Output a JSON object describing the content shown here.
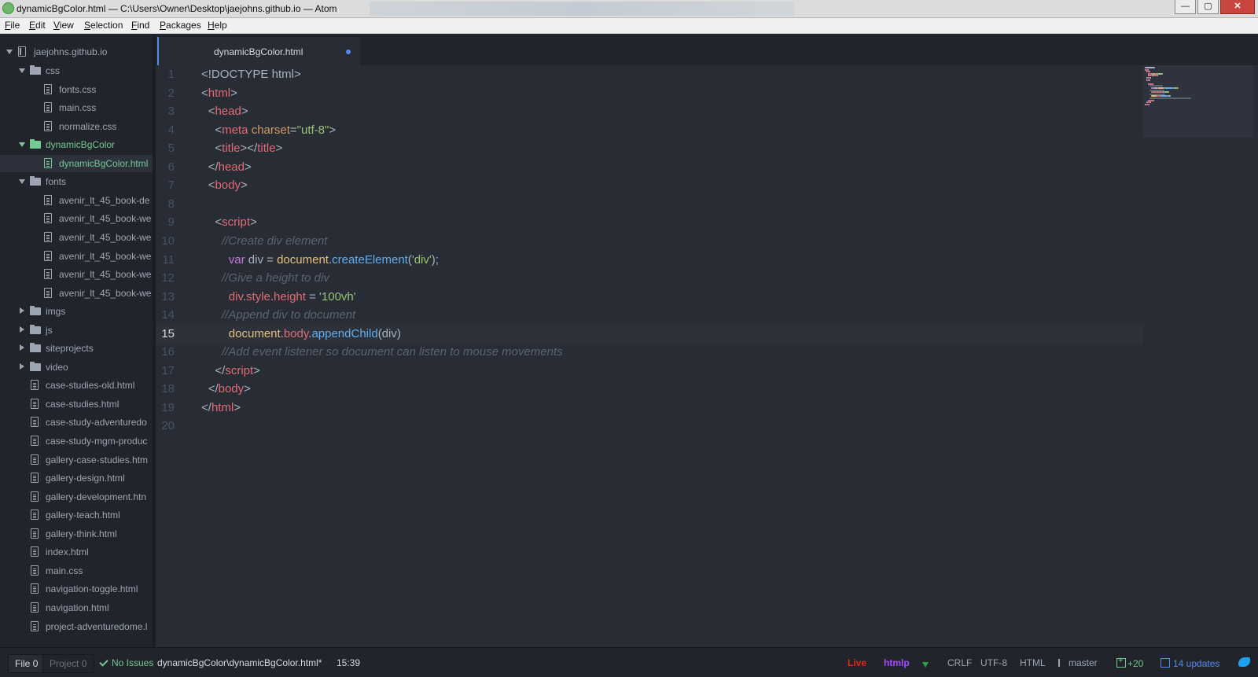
{
  "window": {
    "title": "dynamicBgColor.html — C:\\Users\\Owner\\Desktop\\jaejohns.github.io — Atom",
    "buttons": {
      "minimize": "—",
      "maximize": "▢",
      "close": "✕"
    }
  },
  "menu": [
    "File",
    "Edit",
    "View",
    "Selection",
    "Find",
    "Packages",
    "Help"
  ],
  "tree": {
    "root": "jaejohns.github.io",
    "items": [
      {
        "label": "css",
        "type": "folder",
        "expanded": true,
        "depth": 1
      },
      {
        "label": "fonts.css",
        "type": "file",
        "depth": 2
      },
      {
        "label": "main.css",
        "type": "file",
        "depth": 2
      },
      {
        "label": "normalize.css",
        "type": "file",
        "depth": 2
      },
      {
        "label": "dynamicBgColor",
        "type": "folder",
        "expanded": true,
        "depth": 1,
        "status": "added"
      },
      {
        "label": "dynamicBgColor.html",
        "type": "file",
        "depth": 2,
        "status": "added",
        "selected": true
      },
      {
        "label": "fonts",
        "type": "folder",
        "expanded": true,
        "depth": 1
      },
      {
        "label": "avenir_lt_45_book-de",
        "type": "file",
        "depth": 2
      },
      {
        "label": "avenir_lt_45_book-we",
        "type": "file",
        "depth": 2
      },
      {
        "label": "avenir_lt_45_book-we",
        "type": "file",
        "depth": 2
      },
      {
        "label": "avenir_lt_45_book-we",
        "type": "file",
        "depth": 2
      },
      {
        "label": "avenir_lt_45_book-we",
        "type": "file",
        "depth": 2
      },
      {
        "label": "avenir_lt_45_book-we",
        "type": "file",
        "depth": 2
      },
      {
        "label": "imgs",
        "type": "folder",
        "expanded": false,
        "depth": 1
      },
      {
        "label": "js",
        "type": "folder",
        "expanded": false,
        "depth": 1
      },
      {
        "label": "siteprojects",
        "type": "folder",
        "expanded": false,
        "depth": 1
      },
      {
        "label": "video",
        "type": "folder",
        "expanded": false,
        "depth": 1
      },
      {
        "label": "case-studies-old.html",
        "type": "file",
        "depth": 1
      },
      {
        "label": "case-studies.html",
        "type": "file",
        "depth": 1
      },
      {
        "label": "case-study-adventuredo",
        "type": "file",
        "depth": 1
      },
      {
        "label": "case-study-mgm-produc",
        "type": "file",
        "depth": 1
      },
      {
        "label": "gallery-case-studies.htm",
        "type": "file",
        "depth": 1
      },
      {
        "label": "gallery-design.html",
        "type": "file",
        "depth": 1
      },
      {
        "label": "gallery-development.htn",
        "type": "file",
        "depth": 1
      },
      {
        "label": "gallery-teach.html",
        "type": "file",
        "depth": 1
      },
      {
        "label": "gallery-think.html",
        "type": "file",
        "depth": 1
      },
      {
        "label": "index.html",
        "type": "file",
        "depth": 1
      },
      {
        "label": "main.css",
        "type": "file",
        "depth": 1
      },
      {
        "label": "navigation-toggle.html",
        "type": "file",
        "depth": 1
      },
      {
        "label": "navigation.html",
        "type": "file",
        "depth": 1
      },
      {
        "label": "project-adventuredome.l",
        "type": "file",
        "depth": 1
      }
    ]
  },
  "tab": {
    "title": "dynamicBgColor.html",
    "modified": true
  },
  "editor": {
    "cursor_line": 15,
    "lines": [
      [
        [
          "<!DOCTYPE html>",
          "plain"
        ]
      ],
      [
        [
          "<",
          "plain"
        ],
        [
          "html",
          "tag"
        ],
        [
          ">",
          "plain"
        ]
      ],
      [
        [
          "<",
          "plain"
        ],
        [
          "head",
          "tag"
        ],
        [
          ">",
          "plain"
        ]
      ],
      [
        [
          "<",
          "plain"
        ],
        [
          "meta",
          "tag"
        ],
        [
          " ",
          "plain"
        ],
        [
          "charset",
          "attr"
        ],
        [
          "=",
          "plain"
        ],
        [
          "\"utf-8\"",
          "string"
        ],
        [
          ">",
          "plain"
        ]
      ],
      [
        [
          "<",
          "plain"
        ],
        [
          "title",
          "tag"
        ],
        [
          "></",
          "plain"
        ],
        [
          "title",
          "tag"
        ],
        [
          ">",
          "plain"
        ]
      ],
      [
        [
          "</",
          "plain"
        ],
        [
          "head",
          "tag"
        ],
        [
          ">",
          "plain"
        ]
      ],
      [
        [
          "<",
          "plain"
        ],
        [
          "body",
          "tag"
        ],
        [
          ">",
          "plain"
        ]
      ],
      [],
      [
        [
          "<",
          "plain"
        ],
        [
          "script",
          "tag"
        ],
        [
          ">",
          "plain"
        ]
      ],
      [
        [
          "//Create div element",
          "comment"
        ]
      ],
      [
        [
          "var",
          "keyword"
        ],
        [
          " div = ",
          "plain"
        ],
        [
          "document",
          "support"
        ],
        [
          ".",
          "plain"
        ],
        [
          "createElement",
          "func"
        ],
        [
          "(",
          "plain"
        ],
        [
          "'div'",
          "string"
        ],
        [
          ");",
          "plain"
        ]
      ],
      [
        [
          "//Give a height to div",
          "comment"
        ]
      ],
      [
        [
          "div",
          "var"
        ],
        [
          ".",
          "plain"
        ],
        [
          "style",
          "var"
        ],
        [
          ".",
          "plain"
        ],
        [
          "height",
          "var"
        ],
        [
          " = ",
          "plain"
        ],
        [
          "'100vh'",
          "string"
        ]
      ],
      [
        [
          "//Append div to document",
          "comment"
        ]
      ],
      [
        [
          "document",
          "support"
        ],
        [
          ".",
          "plain"
        ],
        [
          "body",
          "var"
        ],
        [
          ".",
          "plain"
        ],
        [
          "appendChild",
          "func"
        ],
        [
          "(div)",
          "plain"
        ]
      ],
      [
        [
          "//Add event listener so document can listen to mouse movements",
          "comment"
        ]
      ],
      [
        [
          "</",
          "plain"
        ],
        [
          "script",
          "tag"
        ],
        [
          ">",
          "plain"
        ]
      ],
      [
        [
          "</",
          "plain"
        ],
        [
          "body",
          "tag"
        ],
        [
          ">",
          "plain"
        ]
      ],
      [
        [
          "</",
          "plain"
        ],
        [
          "html",
          "tag"
        ],
        [
          ">",
          "plain"
        ]
      ],
      []
    ],
    "indents": [
      0,
      0,
      1,
      2,
      2,
      1,
      1,
      0,
      2,
      3,
      4,
      3,
      4,
      3,
      4,
      3,
      2,
      1,
      0,
      0
    ]
  },
  "colors": {
    "plain": "#abb2bf",
    "tag": "#e06c75",
    "attr": "#d19a66",
    "string": "#98c379",
    "comment": "#5c6370",
    "keyword": "#c678dd",
    "support": "#e5c07b",
    "func": "#61afef",
    "var": "#e06c75",
    "accent": "#568af2",
    "git_added": "#73c990",
    "live": "#e5271c",
    "grammar": "#a64dff"
  },
  "status": {
    "file_tab": "File",
    "file_count": "0",
    "project_tab": "Project",
    "project_count": "0",
    "no_issues": "No Issues",
    "path": "dynamicBgColor\\dynamicBgColor.html*",
    "cursor_pos": "15:39",
    "live": "Live",
    "grammar_pkg": "htmlp",
    "line_ending": "CRLF",
    "encoding": "UTF-8",
    "grammar": "HTML",
    "branch": "master",
    "diff": "+20",
    "updates": "14 updates"
  }
}
